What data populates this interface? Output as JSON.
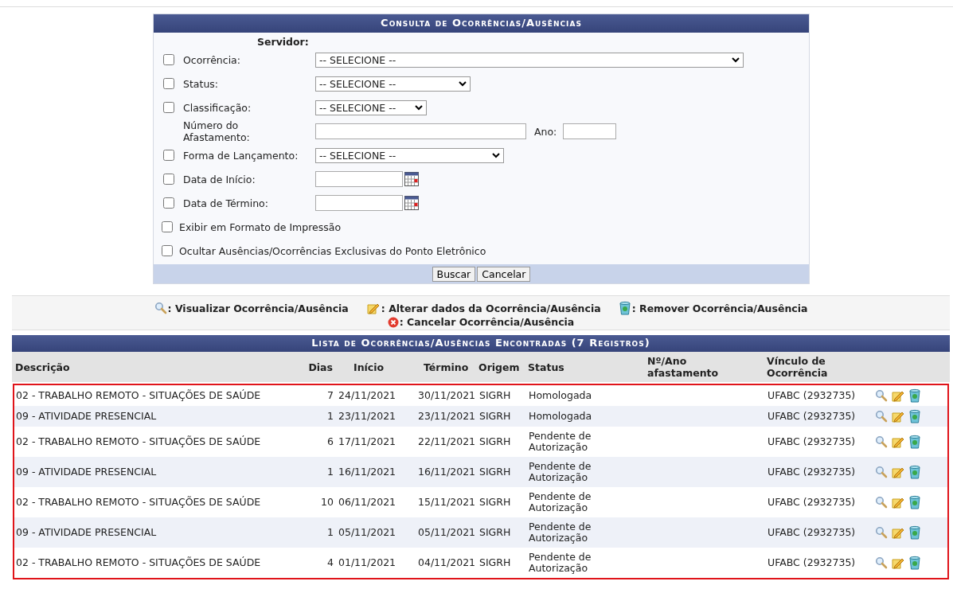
{
  "form": {
    "title": "Consulta de Ocorrências/Ausências",
    "server_label": "Servidor:",
    "fields": [
      {
        "kind": "select",
        "label": "Ocorrência:",
        "checked": false,
        "value": "-- SELECIONE --"
      },
      {
        "kind": "select",
        "label": "Status:",
        "checked": false,
        "value": "-- SELECIONE --"
      },
      {
        "kind": "select",
        "label": "Classificação:",
        "checked": false,
        "value": "-- SELECIONE --"
      },
      {
        "kind": "number",
        "label": "Número do Afastamento:",
        "extra_label": "Ano:"
      },
      {
        "kind": "select",
        "label": "Forma de Lançamento:",
        "checked": false,
        "value": "-- SELECIONE --"
      },
      {
        "kind": "date",
        "label": "Data de Início:",
        "checked": false
      },
      {
        "kind": "date",
        "label": "Data de Término:",
        "checked": false
      }
    ],
    "options": [
      {
        "label": "Exibir em Formato de Impressão",
        "checked": false
      },
      {
        "label": "Ocultar Ausências/Ocorrências Exclusivas do Ponto Eletrônico",
        "checked": false
      }
    ],
    "buttons": [
      "Buscar",
      "Cancelar"
    ]
  },
  "legend": [
    {
      "kind": "view",
      "label": ": Visualizar Ocorrência/Ausência"
    },
    {
      "kind": "edit",
      "label": ": Alterar dados da Ocorrência/Ausência"
    },
    {
      "kind": "remove",
      "label": ": Remover Ocorrência/Ausência"
    },
    {
      "kind": "cancel",
      "label": ": Cancelar Ocorrência/Ausência"
    }
  ],
  "table": {
    "title": "Lista de Ocorrências/Ausências Encontradas (7 Registros)",
    "columns": [
      "Descrição",
      "Dias",
      "Início",
      "Término",
      "Origem",
      "Status",
      "Nº/Ano afastamento",
      "Vínculo de Ocorrência"
    ],
    "rows": [
      {
        "cells": [
          "02 - TRABALHO REMOTO - SITUAÇÕES DE SAÚDE",
          "7",
          "24/11/2021",
          "30/11/2021",
          "SIGRH",
          "Homologada",
          "",
          "UFABC (2932735)"
        ]
      },
      {
        "cells": [
          "09 - ATIVIDADE PRESENCIAL",
          "1",
          "23/11/2021",
          "23/11/2021",
          "SIGRH",
          "Homologada",
          "",
          "UFABC (2932735)"
        ]
      },
      {
        "cells": [
          "02 - TRABALHO REMOTO - SITUAÇÕES DE SAÚDE",
          "6",
          "17/11/2021",
          "22/11/2021",
          "SIGRH",
          "Pendente de Autorização",
          "",
          "UFABC (2932735)"
        ]
      },
      {
        "cells": [
          "09 - ATIVIDADE PRESENCIAL",
          "1",
          "16/11/2021",
          "16/11/2021",
          "SIGRH",
          "Pendente de Autorização",
          "",
          "UFABC (2932735)"
        ]
      },
      {
        "cells": [
          "02 - TRABALHO REMOTO - SITUAÇÕES DE SAÚDE",
          "10",
          "06/11/2021",
          "15/11/2021",
          "SIGRH",
          "Pendente de Autorização",
          "",
          "UFABC (2932735)"
        ]
      },
      {
        "cells": [
          "09 - ATIVIDADE PRESENCIAL",
          "1",
          "05/11/2021",
          "05/11/2021",
          "SIGRH",
          "Pendente de Autorização",
          "",
          "UFABC (2932735)"
        ]
      },
      {
        "cells": [
          "02 - TRABALHO REMOTO - SITUAÇÕES DE SAÚDE",
          "4",
          "01/11/2021",
          "04/11/2021",
          "SIGRH",
          "Pendente de Autorização",
          "",
          "UFABC (2932735)"
        ]
      }
    ]
  }
}
